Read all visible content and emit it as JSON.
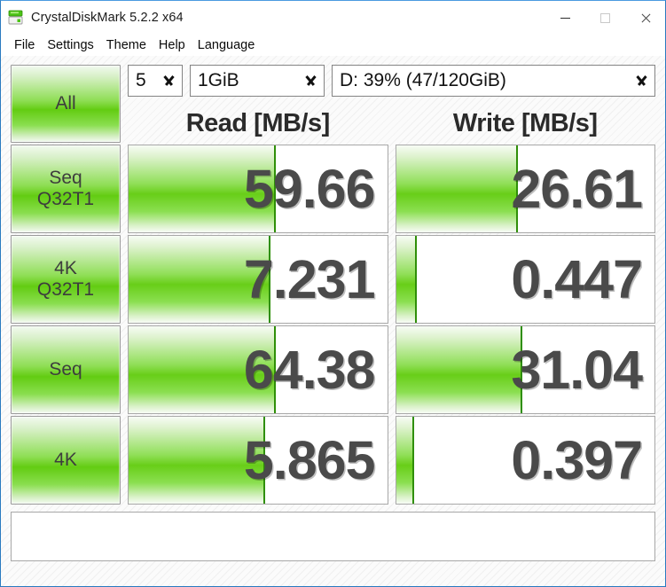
{
  "window": {
    "title": "CrystalDiskMark 5.2.2 x64",
    "icon": "disk-drive-icon",
    "minimize_label": "Minimize",
    "maximize_label": "Maximize",
    "close_label": "Close"
  },
  "menu": {
    "items": [
      {
        "label": "File"
      },
      {
        "label": "Settings"
      },
      {
        "label": "Theme"
      },
      {
        "label": "Help"
      },
      {
        "label": "Language"
      }
    ]
  },
  "controls": {
    "run_count": "5",
    "test_size": "1GiB",
    "target_drive": "D: 39% (47/120GiB)"
  },
  "buttons": {
    "all": "All"
  },
  "headers": {
    "read": "Read [MB/s]",
    "write": "Write [MB/s]"
  },
  "comment": {
    "value": "",
    "placeholder": ""
  },
  "colors": {
    "accent_green": "#63cc12",
    "bar_edge": "#2f8f08",
    "title_border": "#2a7ac0",
    "score_text": "#4a4a4a"
  },
  "chart_data": {
    "type": "bar",
    "title": "CrystalDiskMark 5.2.2 x64 benchmark results",
    "xlabel": "",
    "ylabel": "MB/s",
    "unit": "MB/s",
    "categories": [
      "Seq Q32T1",
      "4K Q32T1",
      "Seq",
      "4K"
    ],
    "series": [
      {
        "name": "Read [MB/s]",
        "values": [
          59.66,
          7.231,
          64.38,
          5.865
        ]
      },
      {
        "name": "Write [MB/s]",
        "values": [
          26.61,
          0.447,
          31.04,
          0.397
        ]
      }
    ],
    "rows": [
      {
        "label_line1": "Seq",
        "label_line2": "Q32T1",
        "read": {
          "value": "59.66",
          "fill_pct": 57
        },
        "write": {
          "value": "26.61",
          "fill_pct": 47
        }
      },
      {
        "label_line1": "4K",
        "label_line2": "Q32T1",
        "read": {
          "value": "7.231",
          "fill_pct": 55
        },
        "write": {
          "value": "0.447",
          "fill_pct": 8
        }
      },
      {
        "label_line1": "Seq",
        "label_line2": "",
        "read": {
          "value": "64.38",
          "fill_pct": 57
        },
        "write": {
          "value": "31.04",
          "fill_pct": 49
        }
      },
      {
        "label_line1": "4K",
        "label_line2": "",
        "read": {
          "value": "5.865",
          "fill_pct": 53
        },
        "write": {
          "value": "0.397",
          "fill_pct": 7
        }
      }
    ],
    "legend": [
      "Read [MB/s]",
      "Write [MB/s]"
    ],
    "legend_position": "top"
  }
}
